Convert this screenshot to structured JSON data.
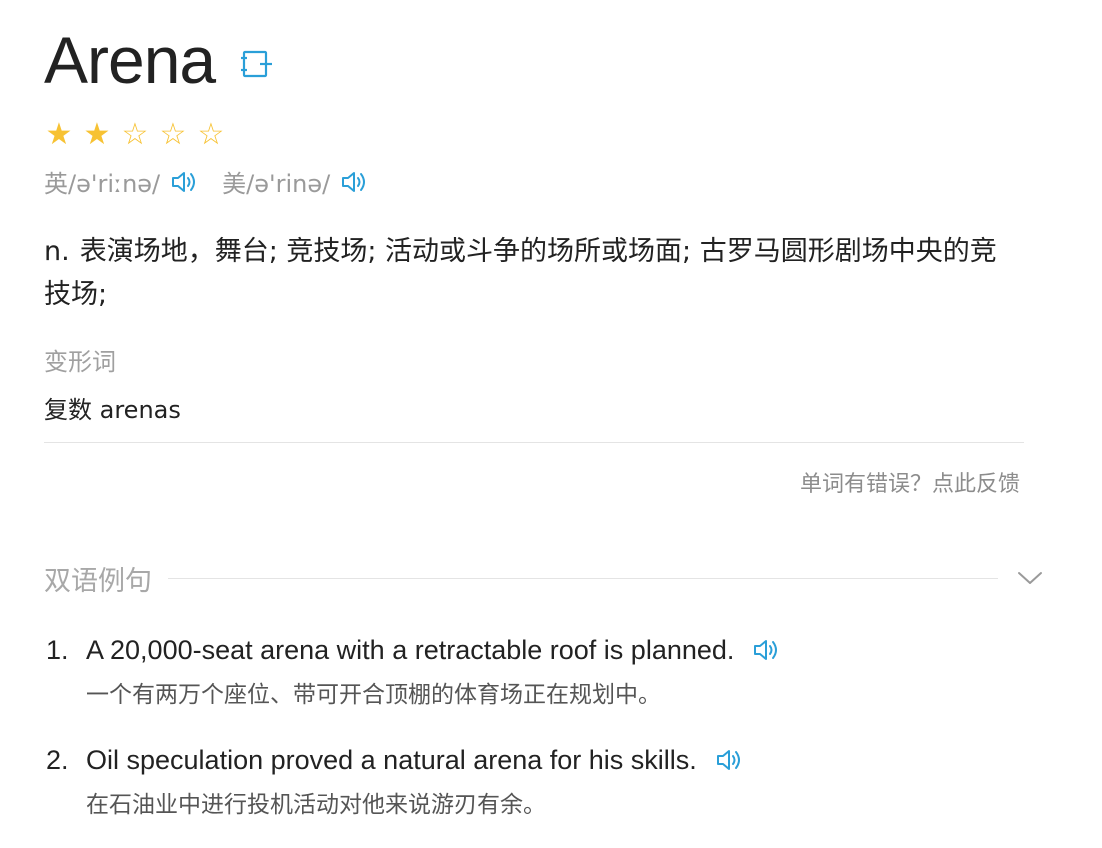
{
  "word": {
    "headword": "Arena",
    "add_icon": "add-to-wordbook-icon",
    "rating": {
      "filled": 2,
      "total": 5
    },
    "phonetics": [
      {
        "label": "英/ə'riːnə/",
        "icon": "speaker-icon"
      },
      {
        "label": "美/ə'rinə/",
        "icon": "speaker-icon"
      }
    ],
    "definition": {
      "pos": "n.",
      "text": "表演场地，舞台; 竞技场; 活动或斗争的场所或场面; 古罗马圆形剧场中央的竞技场;"
    },
    "forms": {
      "label": "变形词",
      "value": "复数 arenas"
    },
    "feedback": "单词有错误？点此反馈"
  },
  "examples_section": {
    "title": "双语例句",
    "toggle_icon": "chevron-down-icon",
    "items": [
      {
        "num": "1.",
        "en": "A 20,000-seat arena with a retractable roof is planned.",
        "cn": "一个有两万个座位、带可开合顶棚的体育场正在规划中。"
      },
      {
        "num": "2.",
        "en": "Oil speculation proved a natural arena for his skills.",
        "cn": "在石油业中进行投机活动对他来说游刃有余。"
      }
    ]
  },
  "colors": {
    "accent": "#2a9fd8",
    "star": "#f7c233",
    "muted": "#9a9a9a"
  }
}
